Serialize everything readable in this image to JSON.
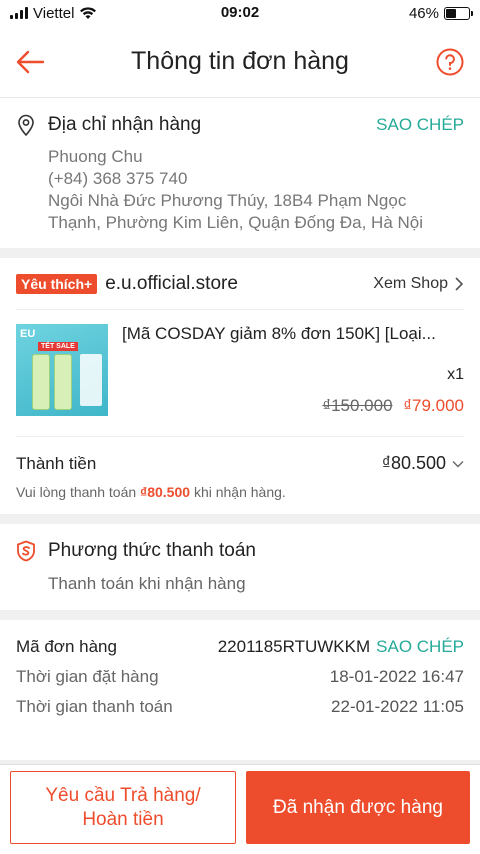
{
  "status_bar": {
    "carrier": "Viettel",
    "time": "09:02",
    "battery_text": "46%",
    "battery_level": 0.46
  },
  "header": {
    "title": "Thông tin đơn hàng",
    "back_icon": "arrow-left-icon",
    "help_icon": "question-circle-icon"
  },
  "address": {
    "title": "Địa chỉ nhận hàng",
    "copy_label": "SAO CHÉP",
    "name": "Phuong Chu",
    "phone": "(+84) 368 375 740",
    "line1": "Ngôi Nhà Đức Phương Thúy, 18B4 Phạm Ngọc",
    "line2": "Thạnh, Phường Kim Liên, Quận Đống Đa, Hà Nội"
  },
  "shop": {
    "badge": "Yêu thích+",
    "name": "e.u.official.store",
    "view_label": "Xem Shop",
    "product": {
      "name": "[Mã COSDAY giảm 8% đơn 150K] [Loại...",
      "quantity": "x1",
      "original_price": "₫150.000",
      "price": "₫79.000",
      "thumb_text": "EU",
      "thumb_tag": "TẾT SALE"
    },
    "total_label": "Thành tiền",
    "total_value": "₫80.500",
    "note_prefix": "Vui lòng thanh toán",
    "note_amount": "₫80.500",
    "note_suffix": "khi nhận hàng."
  },
  "payment": {
    "title": "Phương thức thanh toán",
    "method": "Thanh toán khi nhận hàng"
  },
  "order": {
    "id_label": "Mã đơn hàng",
    "id_value": "2201185RTUWKKM",
    "copy_label": "SAO CHÉP",
    "placed_label": "Thời gian đặt hàng",
    "placed_value": "18-01-2022 16:47",
    "paid_label": "Thời gian thanh toán",
    "paid_value": "22-01-2022 11:05"
  },
  "actions": {
    "return_line1": "Yêu cầu Trả hàng/",
    "return_line2": "Hoàn tiền",
    "received": "Đã nhận được hàng"
  },
  "colors": {
    "accent": "#ee4d2d",
    "teal": "#26aa99"
  }
}
